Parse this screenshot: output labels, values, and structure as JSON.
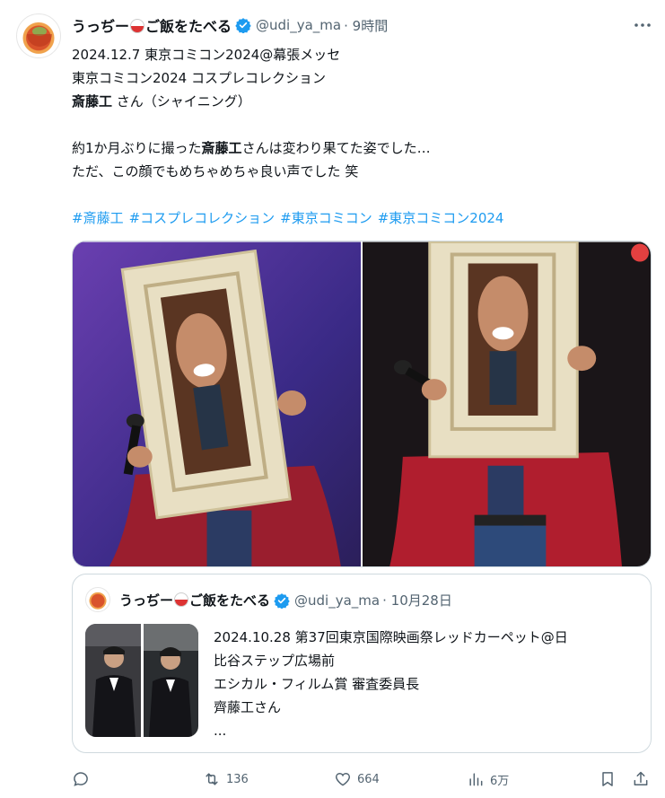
{
  "post": {
    "author": {
      "name_part1": "うっぢー",
      "name_part2": "ご飯をたべる",
      "handle": "@udi_ya_ma",
      "time": "· 9時間"
    },
    "lines": [
      "2024.12.7 東京コミコン2024@幕張メッセ",
      "東京コミコン2024 コスプレコレクション"
    ],
    "line3_bold": "斎藤工",
    "line3_rest": " さん（シャイニング）",
    "line4_pre": "約1か月ぶりに撮った",
    "line4_bold": "斎藤工",
    "line4_post": "さんは変わり果てた姿でした…",
    "line5": "ただ、この顔でもめちゃめちゃ良い声でした 笑",
    "hashtags": [
      "#斎藤工",
      "#コスプレコレクション",
      "#東京コミコン",
      "#東京コミコン2024"
    ]
  },
  "quote": {
    "author": {
      "name_part1": "うっぢー",
      "name_part2": "ご飯をたべる",
      "handle": "@udi_ya_ma",
      "time": "· 10月28日"
    },
    "lines": [
      "2024.10.28 第37回東京国際映画祭レッドカーペット@日",
      "比谷ステップ広場前",
      "エシカル・フィルム賞 審査委員長",
      "齊藤工さん",
      "..."
    ]
  },
  "actions": {
    "reply": "",
    "retweet": "136",
    "like": "664",
    "views": "6万"
  },
  "icons": {
    "more": "more-icon",
    "verified": "verified-icon",
    "reply": "reply-icon",
    "retweet": "retweet-icon",
    "like": "heart-icon",
    "views": "views-icon",
    "bookmark": "bookmark-icon",
    "share": "share-icon"
  },
  "colors": {
    "link": "#1d9bf0",
    "verified": "#1d9bf0",
    "muted": "#536471"
  }
}
